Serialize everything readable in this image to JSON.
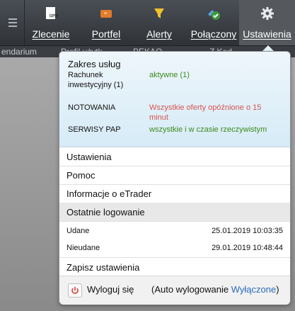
{
  "toolbar": {
    "items": [
      {
        "label": "Zlecenie",
        "icon": "order-icon"
      },
      {
        "label": "Portfel",
        "icon": "wallet-icon"
      },
      {
        "label": "Alerty",
        "icon": "alert-icon"
      },
      {
        "label": "Połączony",
        "icon": "connected-icon"
      },
      {
        "label": "Ustawienia",
        "icon": "gear-icon"
      }
    ]
  },
  "strip": {
    "items": [
      "endarium",
      "Profil użytk.",
      "PEKAO",
      "Z Kod"
    ]
  },
  "services": {
    "title": "Zakres usług",
    "rows": [
      {
        "key": "Rachunek inwestycyjny (1)",
        "value": "aktywne (1)",
        "status": "green"
      },
      {
        "key": "NOTOWANIA",
        "value": "Wszystkie oferty opóźnione o 15 minut",
        "status": "red"
      },
      {
        "key": "SERWISY PAP",
        "value": "wszystkie i w czasie rzeczywistym",
        "status": "green"
      }
    ]
  },
  "menu": {
    "settings": "Ustawienia",
    "help": "Pomoc",
    "about": "Informacje o eTrader",
    "last_login_header": "Ostatnie logowanie",
    "success_label": "Udane",
    "success_date": "25.01.2019 10:03:35",
    "failed_label": "Nieudane",
    "failed_date": "29.01.2019 10:48:44",
    "save_settings": "Zapisz ustawienia"
  },
  "footer": {
    "logout": "Wyloguj się",
    "auto_prefix": "(Auto wylogowanie ",
    "auto_link": "Wyłączone",
    "auto_suffix": ")"
  },
  "colors": {
    "green": "#3d8a1c",
    "red": "#d9534f",
    "link": "#2a6bbd"
  }
}
